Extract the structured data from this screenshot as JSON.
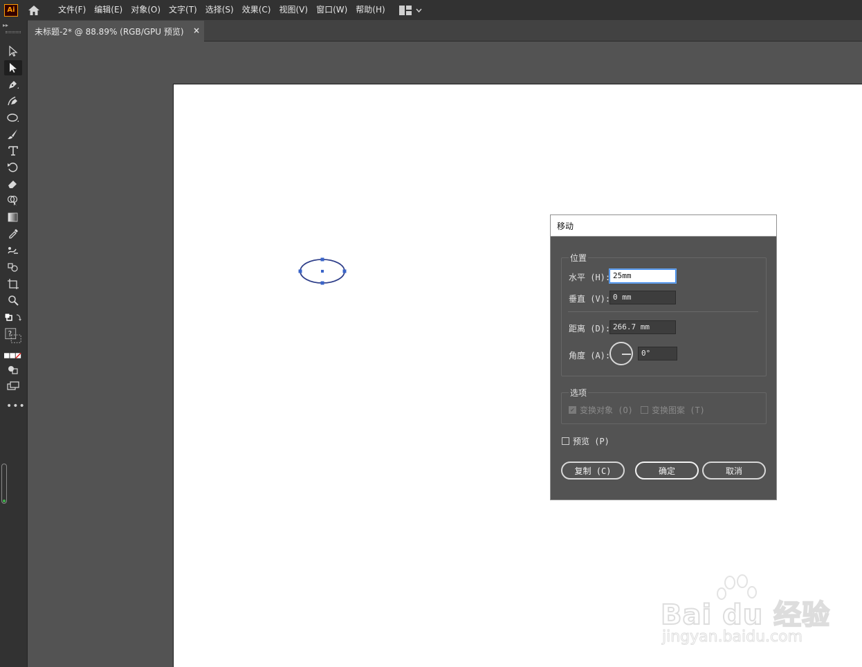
{
  "app": {
    "logo_text": "Ai",
    "menu": [
      "文件(F)",
      "编辑(E)",
      "对象(O)",
      "文字(T)",
      "选择(S)",
      "效果(C)",
      "视图(V)",
      "窗口(W)",
      "帮助(H)"
    ]
  },
  "document_tab": {
    "title": "未标题-2* @ 88.89% (RGB/GPU 预览)",
    "close_label": "×"
  },
  "toolbar": {
    "more_label": "•••",
    "tools": [
      "selection-tool",
      "direct-selection-tool",
      "pen-tool",
      "curvature-tool",
      "ellipse-tool",
      "paintbrush-tool",
      "type-tool",
      "rotate-tool",
      "eraser-tool",
      "shape-builder-tool",
      "gradient-tool",
      "eyedropper-tool",
      "puppet-warp-tool",
      "symbol-sprayer-tool",
      "artboard-tool",
      "zoom-tool"
    ]
  },
  "dialog": {
    "title": "移动",
    "position_group": "位置",
    "horizontal_label": "水平 (H):",
    "horizontal_value": "25mm",
    "vertical_label": "垂直 (V):",
    "vertical_value": "0 mm",
    "distance_label": "距离 (D):",
    "distance_value": "266.7 mm",
    "angle_label": "角度 (A):",
    "angle_value": "0°",
    "options_group": "选项",
    "transform_objects": "变换对象 (O)",
    "transform_patterns": "变换图案 (T)",
    "preview_label": "预览 (P)",
    "copy_button": "复制 (C)",
    "ok_button": "确定",
    "cancel_button": "取消"
  },
  "watermark": {
    "main": "Bai du 经验",
    "url": "jingyan.baidu.com"
  },
  "colors": {
    "accent_selection": "#3a64c8",
    "focus_border": "#3a86e8",
    "memory_indicator": "#3fb24a"
  }
}
